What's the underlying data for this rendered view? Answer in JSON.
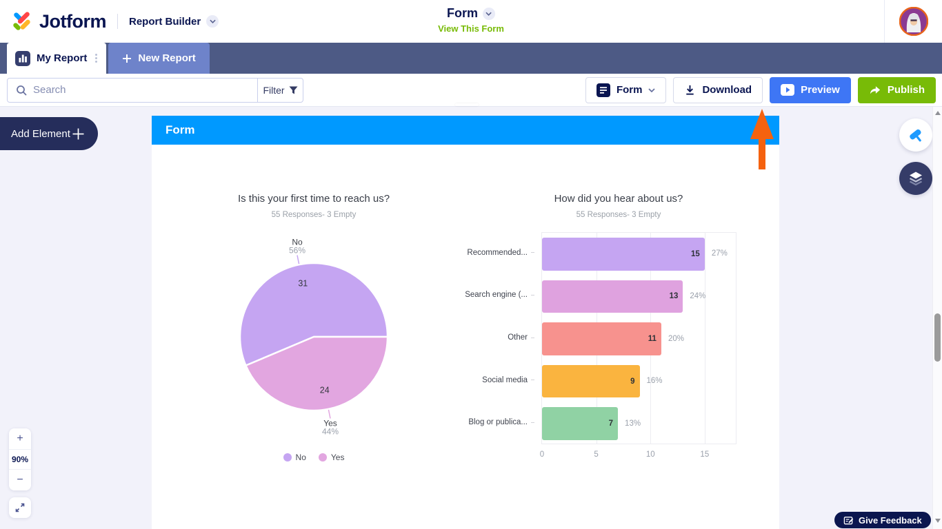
{
  "header": {
    "logo": "Jotform",
    "product_label": "Report Builder",
    "title": "Form",
    "view_link": "View This Form"
  },
  "tabbar": {
    "my_report": "My Report",
    "new_report": "New Report"
  },
  "toolbar": {
    "search_placeholder": "Search",
    "filter": "Filter",
    "form_button": "Form",
    "download": "Download",
    "preview": "Preview",
    "publish": "Publish"
  },
  "canvas": {
    "add_element": "Add Element",
    "panel_title": "Form",
    "zoom_in": "+",
    "zoom_level": "90%",
    "zoom_out": "−",
    "feedback": "Give Feedback"
  },
  "colors": {
    "navy": "#0a1551",
    "tabbar_bg": "#4d5a85",
    "section_blue": "#0099ff",
    "preview_blue": "#3e76f5",
    "publish_green": "#78bb07",
    "annotation_orange": "#f5620f"
  },
  "chart_data": [
    {
      "type": "pie",
      "title": "Is this your first time to reach us?",
      "subtitle": "55 Responses- 3 Empty",
      "slices": [
        {
          "label": "No",
          "value": 31,
          "percent": "56%",
          "color": "#c5a5f2"
        },
        {
          "label": "Yes",
          "value": 24,
          "percent": "44%",
          "color": "#e2a6e0"
        }
      ],
      "legend": [
        "No",
        "Yes"
      ],
      "legend_position": "bottom"
    },
    {
      "type": "bar",
      "title": "How did you hear about us?",
      "subtitle": "55 Responses- 3 Empty",
      "categories": [
        "Recommended...",
        "Search engine (...",
        "Other",
        "Social media",
        "Blog or publica..."
      ],
      "values": [
        15,
        13,
        11,
        9,
        7
      ],
      "percents": [
        "27%",
        "24%",
        "20%",
        "16%",
        "13%"
      ],
      "colors": [
        "#c5a5f2",
        "#dfa2df",
        "#f7928e",
        "#fab43f",
        "#90d2a4"
      ],
      "xticks": [
        0,
        5,
        10,
        15
      ],
      "xlim": [
        0,
        18
      ],
      "grid": true
    }
  ]
}
